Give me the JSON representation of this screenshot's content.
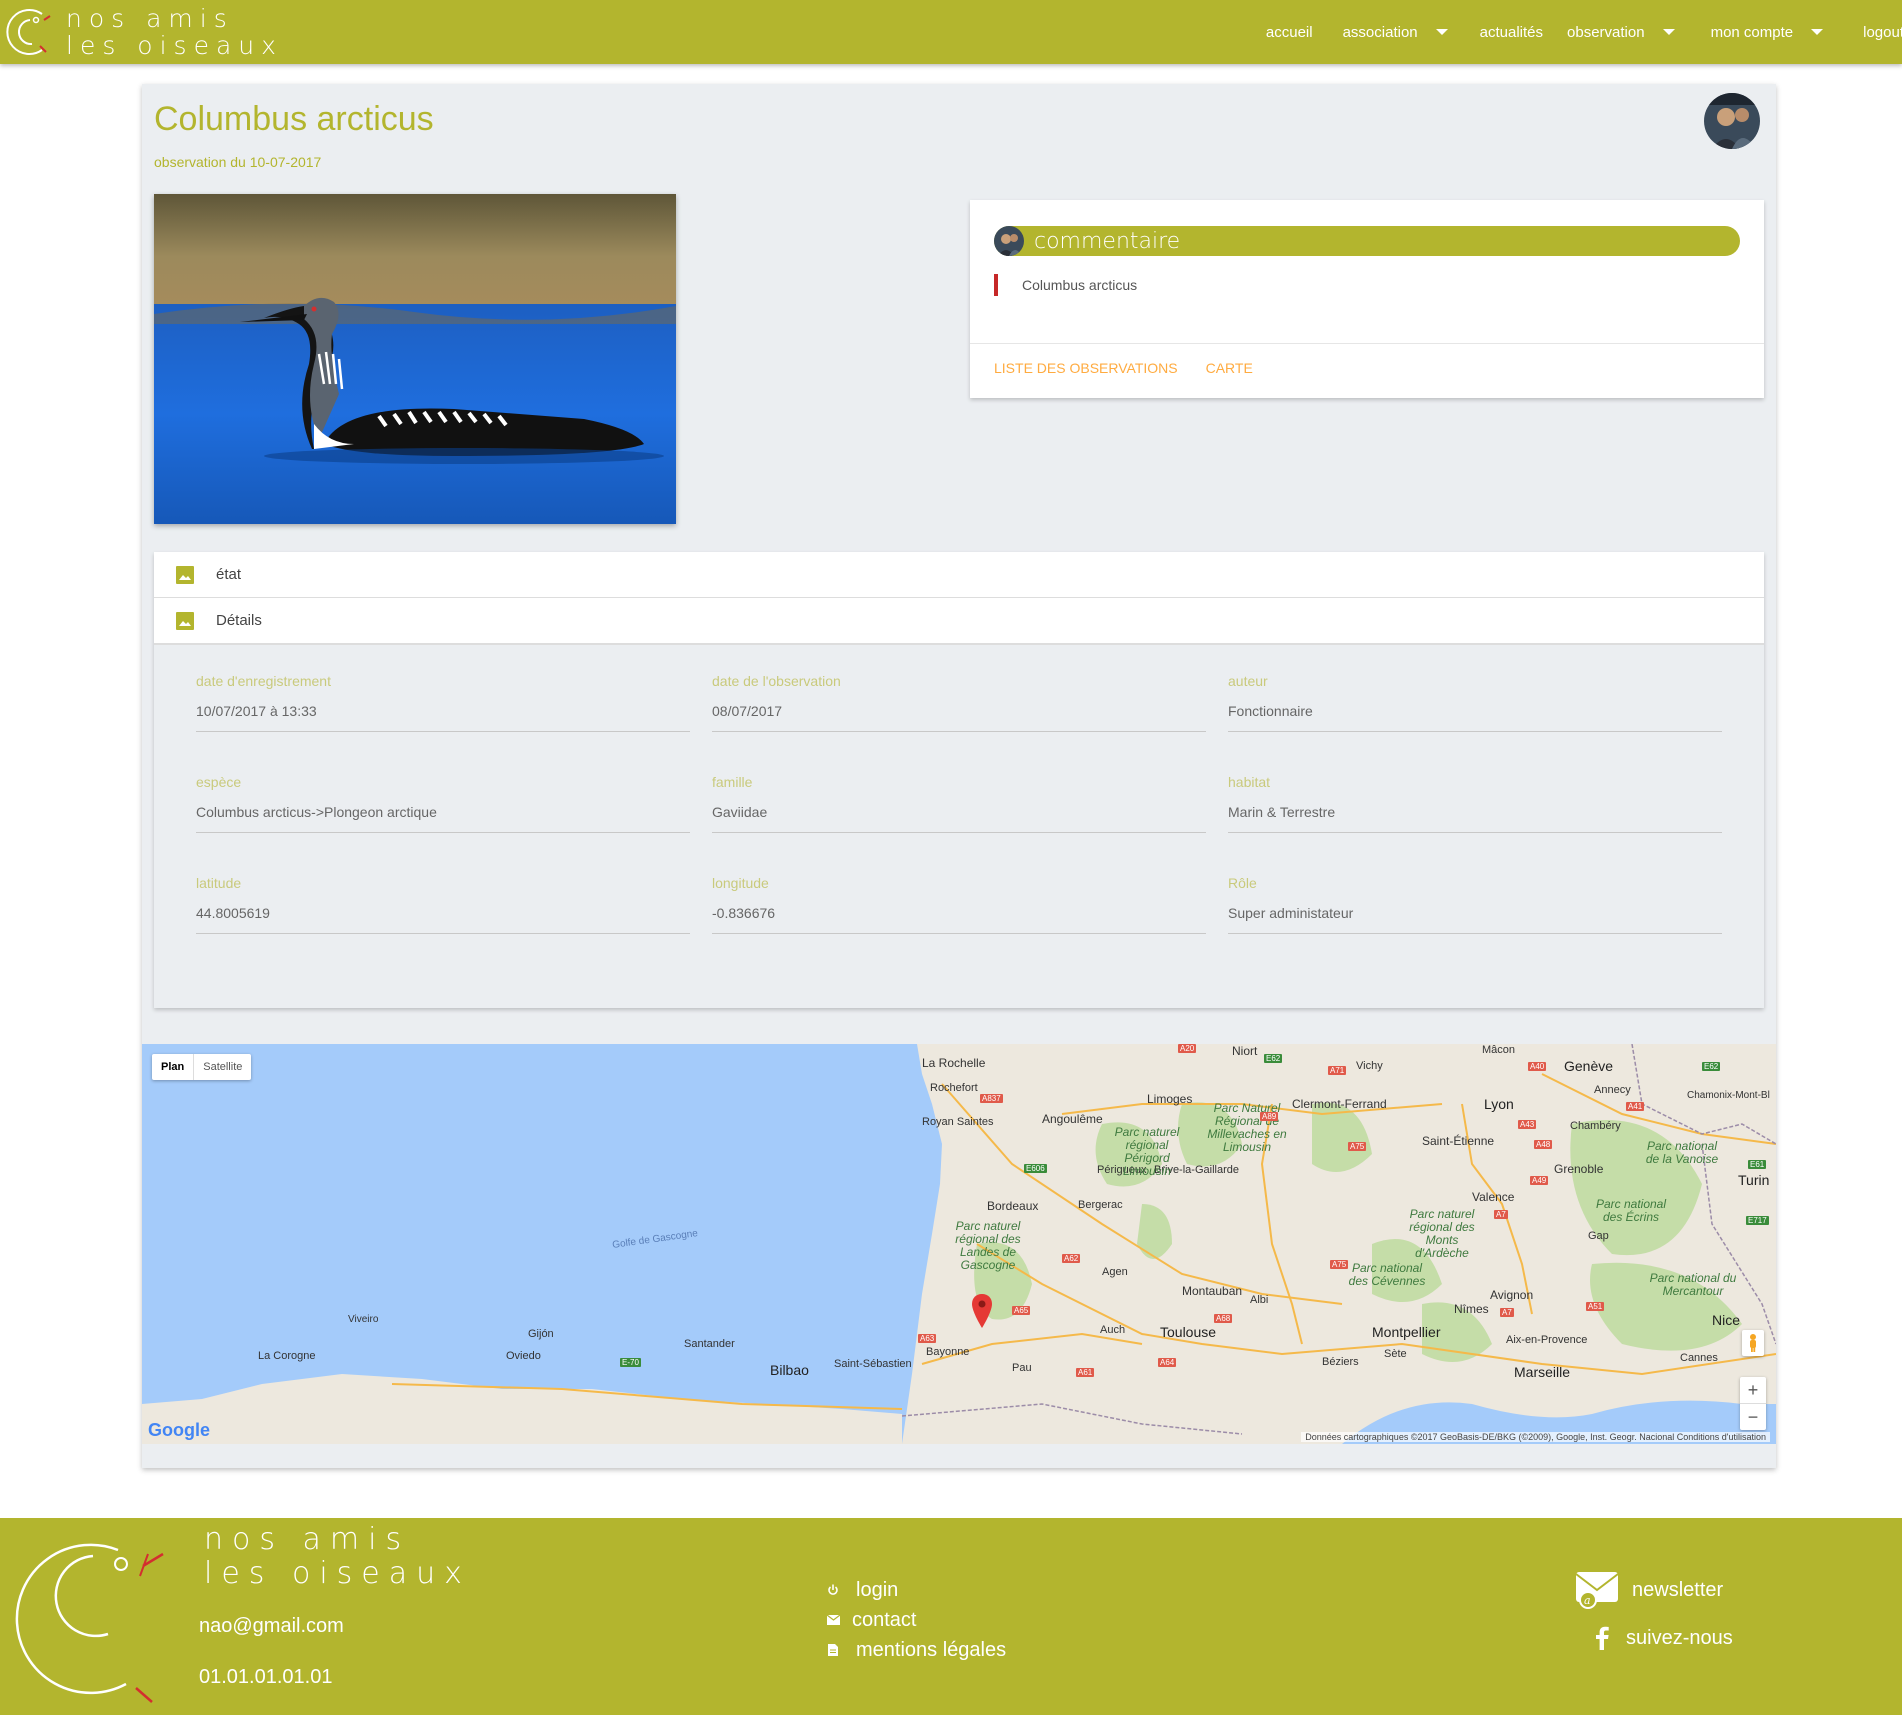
{
  "brand": {
    "line1": "nos amis",
    "line2": "les oiseaux"
  },
  "nav": {
    "items": [
      {
        "label": "accueil",
        "dropdown": false
      },
      {
        "label": "association",
        "dropdown": true
      },
      {
        "label": "actualités",
        "dropdown": false
      },
      {
        "label": "observation",
        "dropdown": true
      },
      {
        "label": "mon compte",
        "dropdown": true
      },
      {
        "label": "logout",
        "dropdown": false
      }
    ]
  },
  "observation": {
    "title": "Columbus arcticus",
    "subtitle": "observation du 10-07-2017"
  },
  "comment": {
    "header": "commentaire",
    "text": "Columbus arcticus",
    "actions": {
      "list": "LISTE DES OBSERVATIONS",
      "map": "CARTE"
    }
  },
  "collapsible": {
    "sections": [
      "état",
      "Détails"
    ]
  },
  "details": {
    "fields": [
      {
        "label": "date d'enregistrement",
        "value": "10/07/2017 à 13:33"
      },
      {
        "label": "date de l'observation",
        "value": "08/07/2017"
      },
      {
        "label": "auteur",
        "value": "Fonctionnaire"
      },
      {
        "label": "espèce",
        "value": "Columbus arcticus->Plongeon arctique"
      },
      {
        "label": "famille",
        "value": "Gaviidae"
      },
      {
        "label": "habitat",
        "value": "Marin & Terrestre"
      },
      {
        "label": "latitude",
        "value": "44.8005619"
      },
      {
        "label": "longitude",
        "value": "-0.836676"
      },
      {
        "label": "Rôle",
        "value": "Super administateur"
      }
    ]
  },
  "map": {
    "types": {
      "plan": "Plan",
      "satellite": "Satellite"
    },
    "sea_label": "Golfe de Gascogne",
    "google": "Google",
    "attribution": "Données cartographiques ©2017 GeoBasis-DE/BKG (©2009), Google, Inst. Geogr. Nacional   Conditions d'utilisation",
    "zoom_in": "+",
    "zoom_out": "−",
    "cities": {
      "laRochelle": "La Rochelle",
      "rochefort": "Rochefort",
      "royan": "Royan Saintes",
      "angouleme": "Angoulême",
      "limoges": "Limoges",
      "clermont": "Clermont-Ferrand",
      "vichy": "Vichy",
      "lyon": "Lyon",
      "geneve": "Genève",
      "annecy": "Annecy",
      "chambery": "Chambéry",
      "chamonix": "Chamonix-Mont-Bl",
      "stEtienne": "Saint-Étienne",
      "grenoble": "Grenoble",
      "turin": "Turin",
      "valence": "Valence",
      "gap": "Gap",
      "perigueux": "Périgueux",
      "brive": "Brive-la-Gaillarde",
      "bordeaux": "Bordeaux",
      "bergerac": "Bergerac",
      "agen": "Agen",
      "montauban": "Montauban",
      "albi": "Albi",
      "toulouse": "Toulouse",
      "auch": "Auch",
      "montpellier": "Montpellier",
      "nimes": "Nîmes",
      "avignon": "Avignon",
      "aix": "Aix-en-Provence",
      "marseille": "Marseille",
      "nice": "Nice",
      "cannes": "Cannes",
      "beziers": "Béziers",
      "sete": "Sète",
      "pau": "Pau",
      "bayonne": "Bayonne",
      "stSebastien": "Saint-Sébastien",
      "bilbao": "Bilbao",
      "santander": "Santander",
      "gijon": "Gijón",
      "oviedo": "Oviedo",
      "viveiro": "Viveiro",
      "laCorogne": "La Corogne",
      "macon": "Mâcon",
      "niort": "Niort"
    },
    "parks": {
      "perigord": "Parc naturel régional Périgord Limousin",
      "millevaches": "Parc Naturel Régional de Millevaches en Limousin",
      "landes": "Parc naturel régional des Landes de Gascogne",
      "ardeche": "Parc naturel régional des Monts d'Ardèche",
      "cevennes": "Parc national des Cévennes",
      "vanoise": "Parc national de la Vanoise",
      "ecrins": "Parc national des Écrins",
      "mercantour": "Parc national du Mercantour"
    },
    "roads": [
      "A20",
      "E62",
      "A71",
      "A40",
      "E62",
      "A837",
      "A89",
      "A41",
      "A43",
      "A75",
      "A48",
      "E606",
      "A49",
      "E61",
      "A7",
      "E717",
      "A62",
      "A75",
      "A65",
      "A68",
      "A7",
      "A51",
      "A63",
      "E-70",
      "A64",
      "A61"
    ]
  },
  "footer": {
    "email": "nao@gmail.com",
    "phone": "01.01.01.01.01",
    "links": {
      "login": "login",
      "contact": "contact",
      "legal": "mentions légales"
    },
    "newsletter": "newsletter",
    "follow": "suivez-nous"
  },
  "colors": {
    "brand": "#b3b52e",
    "accent_orange": "#ffab40",
    "comment_bar": "#c62828",
    "map_sea": "#a4cbfa"
  }
}
